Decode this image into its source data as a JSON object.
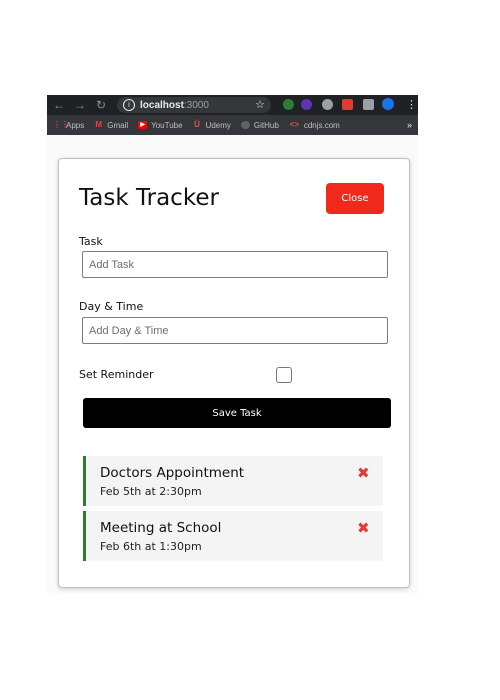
{
  "browser": {
    "url_host": "localhost",
    "url_port": ":3000",
    "nav": {
      "back": "←",
      "forward": "→",
      "reload": "↻"
    },
    "star": "☆",
    "menu": "⋮",
    "bookmarks": [
      {
        "label": "Apps",
        "icon": "apps-grid-icon",
        "color": "#ea4335"
      },
      {
        "label": "Gmail",
        "icon": "gmail-icon",
        "color": "#ea4335"
      },
      {
        "label": "YouTube",
        "icon": "youtube-icon",
        "color": "#ff0000"
      },
      {
        "label": "Udemy",
        "icon": "udemy-icon",
        "color": "#ec5252"
      },
      {
        "label": "GitHub",
        "icon": "github-icon",
        "color": "#8c8f93"
      },
      {
        "label": "cdnjs.com",
        "icon": "code-icon",
        "color": "#d9534f"
      }
    ],
    "bookmarks_more": "»"
  },
  "app": {
    "title": "Task Tracker",
    "close_label": "Close",
    "close_color": "#f1291b",
    "form": {
      "task_label": "Task",
      "task_placeholder": "Add Task",
      "day_label": "Day & Time",
      "day_placeholder": "Add Day & Time",
      "reminder_label": "Set Reminder",
      "reminder_checked": false,
      "save_label": "Save Task"
    },
    "tasks": [
      {
        "text": "Doctors Appointment",
        "day": "Feb 5th at 2:30pm",
        "reminder": true
      },
      {
        "text": "Meeting at School",
        "day": "Feb 6th at 1:30pm",
        "reminder": true
      }
    ],
    "delete_icon": "✖"
  }
}
